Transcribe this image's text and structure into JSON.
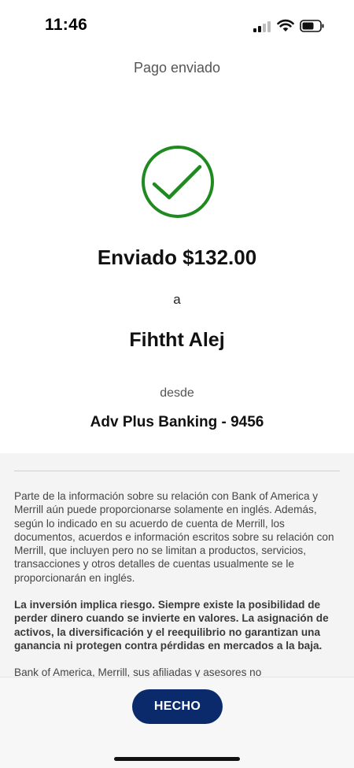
{
  "status_bar": {
    "time": "11:46",
    "icons": [
      "cellular-signal-icon",
      "wifi-icon",
      "battery-icon"
    ]
  },
  "header": {
    "title": "Pago enviado"
  },
  "confirmation": {
    "icon": "checkmark-circle-icon",
    "accent_color": "#1f8a1f",
    "sent_text": "Enviado $132.00",
    "to_label": "a",
    "recipient_name": "Fihtht Alej",
    "from_label": "desde",
    "account": "Adv Plus Banking - 9456"
  },
  "disclosure": {
    "paragraph_1": "Parte de la información sobre su relación con Bank of America y Merrill aún puede proporcionarse solamente en inglés. Además, según lo indicado en su acuerdo de cuenta de Merrill, los documentos, acuerdos e información escritos sobre su relación con Merrill, que incluyen pero no se limitan a productos, servicios, transacciones y otros detalles de cuentas usualmente se le proporcionarán en inglés.",
    "paragraph_2": "La inversión implica riesgo. Siempre existe la posibilidad de perder dinero cuando se invierte en valores. La asignación de activos, la diversificación y el reequilibrio no garantizan una ganancia ni protegen contra pérdidas en mercados a la baja.",
    "paragraph_3": "Bank of America, Merrill, sus afiliadas y asesores no"
  },
  "footer": {
    "done_label": "HECHO",
    "button_color": "#0a2a6b"
  }
}
